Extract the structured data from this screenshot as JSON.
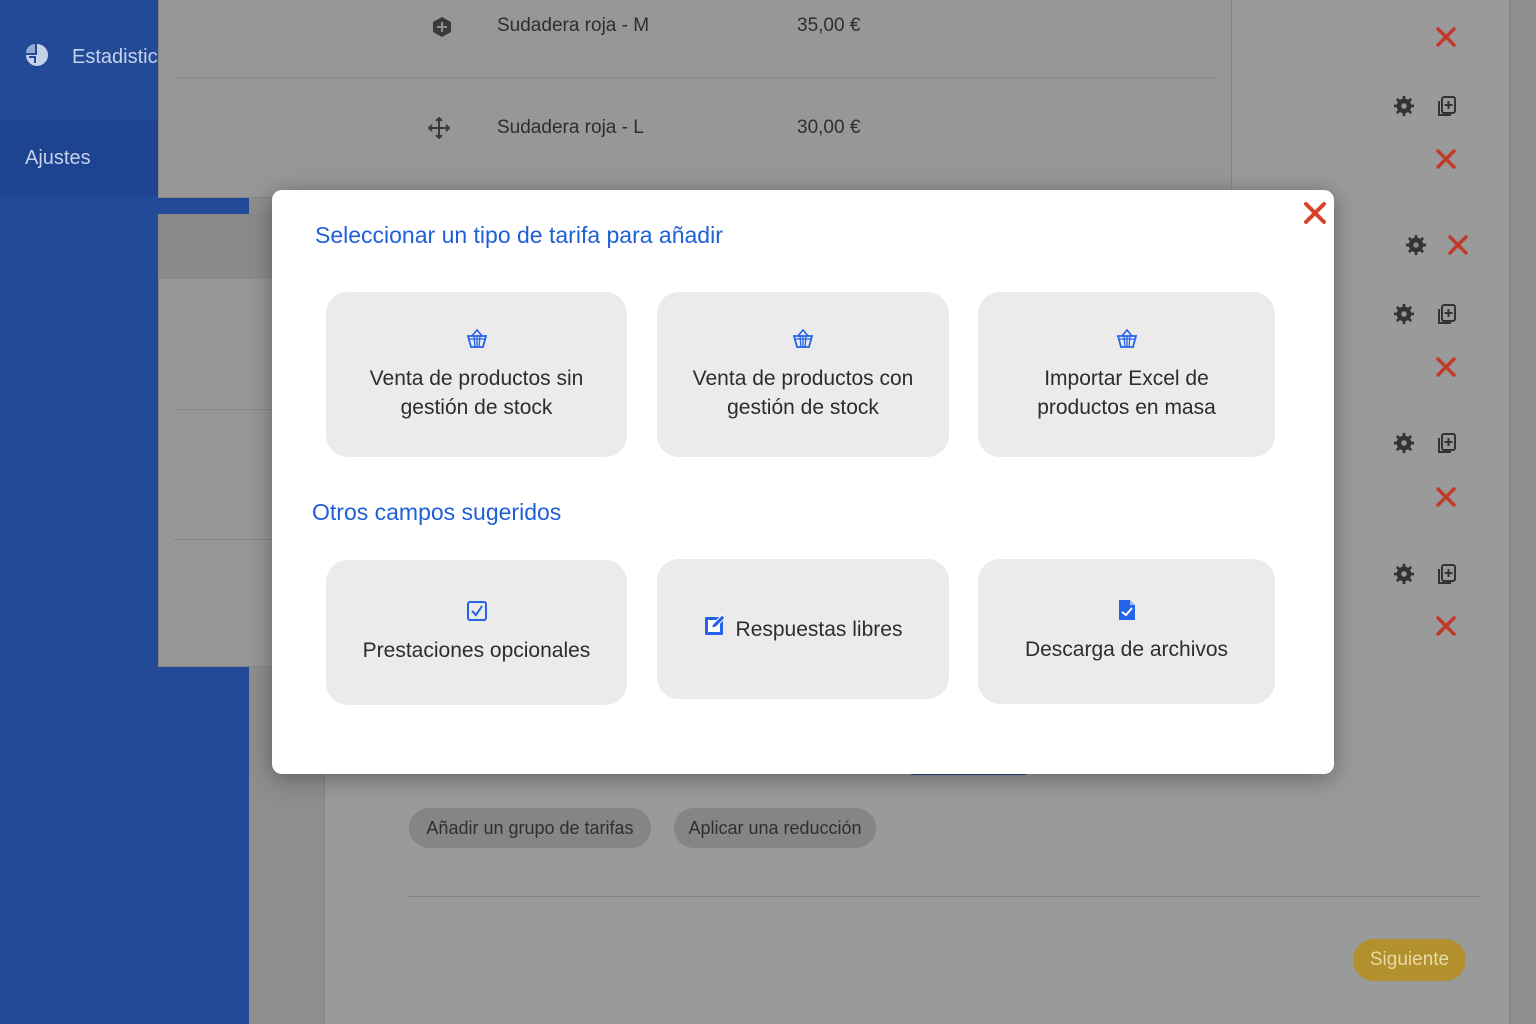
{
  "sidebar": {
    "items": [
      {
        "label": "Estadisticas",
        "icon": "pie-chart-icon"
      },
      {
        "label": "Ajustes",
        "icon": "gear-icon"
      }
    ]
  },
  "list": {
    "rows": [
      {
        "name": "Sudadera roja - M",
        "price": "35,00 €"
      },
      {
        "name": "Sudadera roja - L",
        "price": "30,00 €"
      }
    ]
  },
  "actions": {
    "add_group": "Añadir un grupo de tarifas",
    "apply_reduction": "Aplicar una reducción",
    "next": "Siguiente"
  },
  "modal": {
    "title": "Seleccionar un tipo de tarifa para añadir",
    "subtitle": "Otros campos sugeridos",
    "rate_types": [
      {
        "label": "Venta de productos sin gestión de stock",
        "icon": "basket-icon"
      },
      {
        "label": "Venta de productos con gestión de stock",
        "icon": "basket-icon"
      },
      {
        "label": "Importar Excel de productos en masa",
        "icon": "basket-icon"
      }
    ],
    "suggested": [
      {
        "label": "Prestaciones opcionales",
        "icon": "checkbox-icon"
      },
      {
        "label": "Respuestas libres",
        "icon": "edit-square-icon"
      },
      {
        "label": "Descarga de archivos",
        "icon": "file-check-icon"
      }
    ]
  },
  "colors": {
    "sidebar": "#234a97",
    "accent_blue": "#1f5fd6",
    "delete_red": "#d9402c",
    "next_button": "#b1902d"
  }
}
